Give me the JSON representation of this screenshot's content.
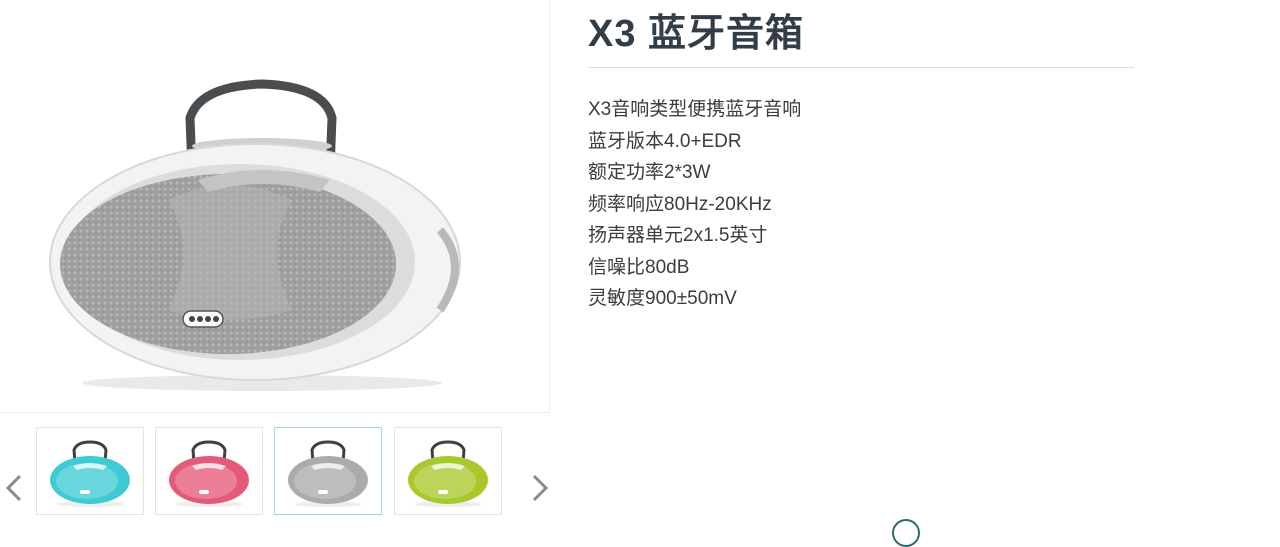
{
  "product": {
    "title": "X3 蓝牙音箱",
    "specs": [
      "X3音响类型便携蓝牙音响",
      "蓝牙版本4.0+EDR",
      "额定功率2*3W",
      "频率响应80Hz-20KHz",
      "扬声器单元2x1.5英寸",
      "信噪比80dB",
      "灵敏度900±50mV"
    ]
  },
  "gallery": {
    "main_color": "#c9cacc",
    "selected_index": 2,
    "thumbnails": [
      {
        "name": "cyan",
        "color": "#3fcbd4"
      },
      {
        "name": "pink",
        "color": "#e45b7a"
      },
      {
        "name": "gray",
        "color": "#a9abad"
      },
      {
        "name": "lime",
        "color": "#a7c92c"
      }
    ],
    "prev_icon": "chevron-left-icon",
    "next_icon": "chevron-right-icon"
  }
}
